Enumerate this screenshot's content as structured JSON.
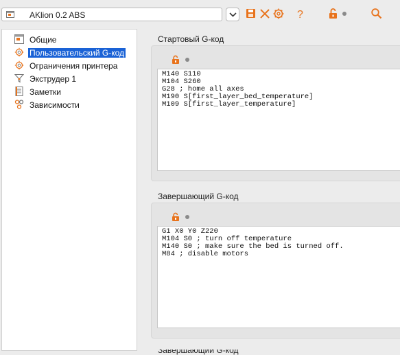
{
  "toolbar": {
    "preset_name": "AKlion 0.2 ABS",
    "icons": [
      "preset-icon",
      "chevron-down-icon",
      "save-icon",
      "delete-icon",
      "compare-icon",
      "help-icon",
      "lock-icon",
      "search-icon"
    ],
    "accent_color": "#e8731c"
  },
  "sidebar": {
    "items": [
      {
        "label": "Общие",
        "icon": "window-icon"
      },
      {
        "label": "Пользовательский G-код",
        "icon": "gear-icon",
        "selected": true
      },
      {
        "label": "Ограничения принтера",
        "icon": "gear-icon"
      },
      {
        "label": "Экструдер 1",
        "icon": "funnel-icon"
      },
      {
        "label": "Заметки",
        "icon": "notes-icon"
      },
      {
        "label": "Зависимости",
        "icon": "dependencies-icon"
      }
    ],
    "selection_color": "#1a62d6"
  },
  "main": {
    "start_gcode": {
      "title": "Стартовый G-код",
      "code": "M140 S110\nM104 S260\nG28 ; home all axes\nM190 S[first_layer_bed_temperature]\nM109 S[first_layer_temperature]"
    },
    "end_gcode": {
      "title": "Завершающий G-код",
      "code": "G1 X0 Y0 Z220\nM104 S0 ; turn off temperature\nM140 S0 ; make sure the bed is turned off.\nM84 ; disable motors"
    },
    "next_section_title": "Завершающий G-код"
  }
}
